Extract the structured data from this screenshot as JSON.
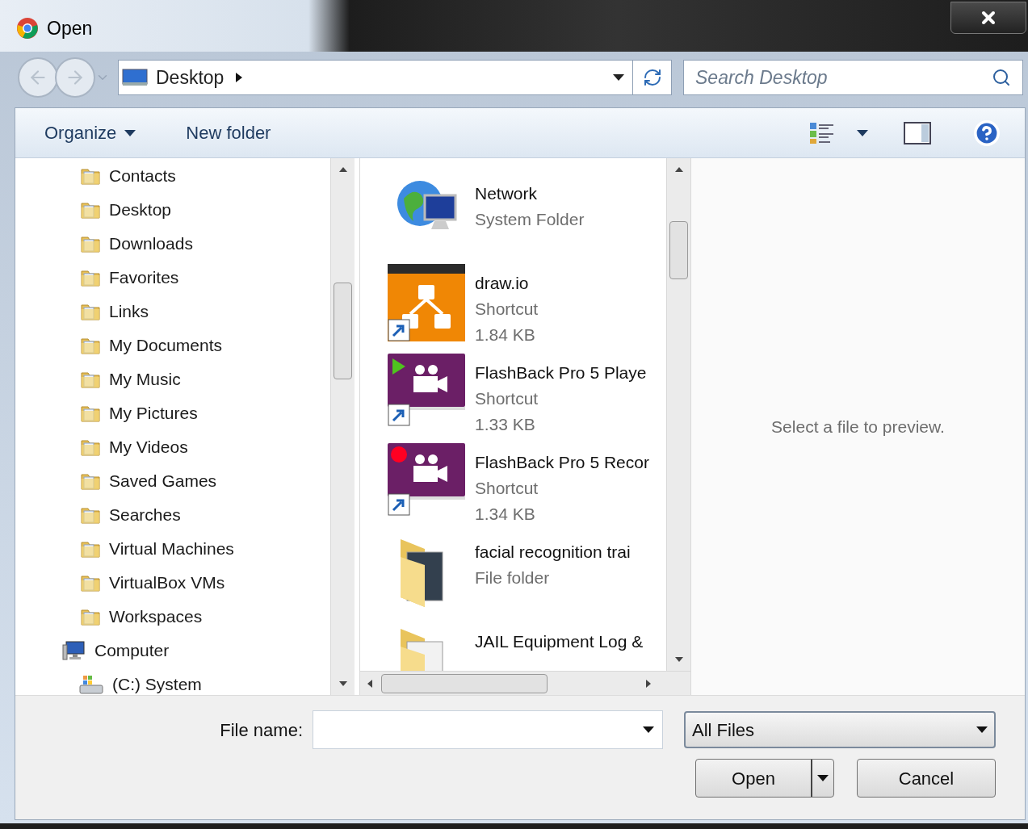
{
  "window": {
    "title": "Open"
  },
  "address": {
    "path": "Desktop"
  },
  "search": {
    "placeholder": "Search Desktop"
  },
  "toolbar": {
    "organize": "Organize",
    "new_folder": "New folder"
  },
  "nav": {
    "items": [
      {
        "label": "Contacts",
        "kind": "folder"
      },
      {
        "label": "Desktop",
        "kind": "folder"
      },
      {
        "label": "Downloads",
        "kind": "folder"
      },
      {
        "label": "Favorites",
        "kind": "folder"
      },
      {
        "label": "Links",
        "kind": "folder"
      },
      {
        "label": "My Documents",
        "kind": "folder"
      },
      {
        "label": "My Music",
        "kind": "folder"
      },
      {
        "label": "My Pictures",
        "kind": "folder"
      },
      {
        "label": "My Videos",
        "kind": "folder"
      },
      {
        "label": "Saved Games",
        "kind": "folder"
      },
      {
        "label": "Searches",
        "kind": "folder"
      },
      {
        "label": "Virtual Machines",
        "kind": "folder"
      },
      {
        "label": "VirtualBox VMs",
        "kind": "folder"
      },
      {
        "label": "Workspaces",
        "kind": "folder"
      },
      {
        "label": "Computer",
        "kind": "computer",
        "children": [
          {
            "label": "(C:) System",
            "kind": "drive"
          }
        ]
      }
    ]
  },
  "files": [
    {
      "name": "Network",
      "type": "System Folder",
      "kind": "network"
    },
    {
      "name": "draw.io",
      "type": "Shortcut",
      "size": "1.84 KB",
      "kind": "drawio"
    },
    {
      "name": "FlashBack Pro 5 Playe",
      "type": "Shortcut",
      "size": "1.33 KB",
      "kind": "player"
    },
    {
      "name": "FlashBack Pro 5 Recor",
      "type": "Shortcut",
      "size": "1.34 KB",
      "kind": "recorder"
    },
    {
      "name": "facial recognition trai",
      "type": "File folder",
      "kind": "folder"
    },
    {
      "name": "JAIL Equipment Log &",
      "kind": "docfolder"
    }
  ],
  "preview": {
    "message": "Select a file to preview."
  },
  "footer": {
    "file_name_label": "File name:",
    "filter": "All Files",
    "open": "Open",
    "cancel": "Cancel"
  }
}
